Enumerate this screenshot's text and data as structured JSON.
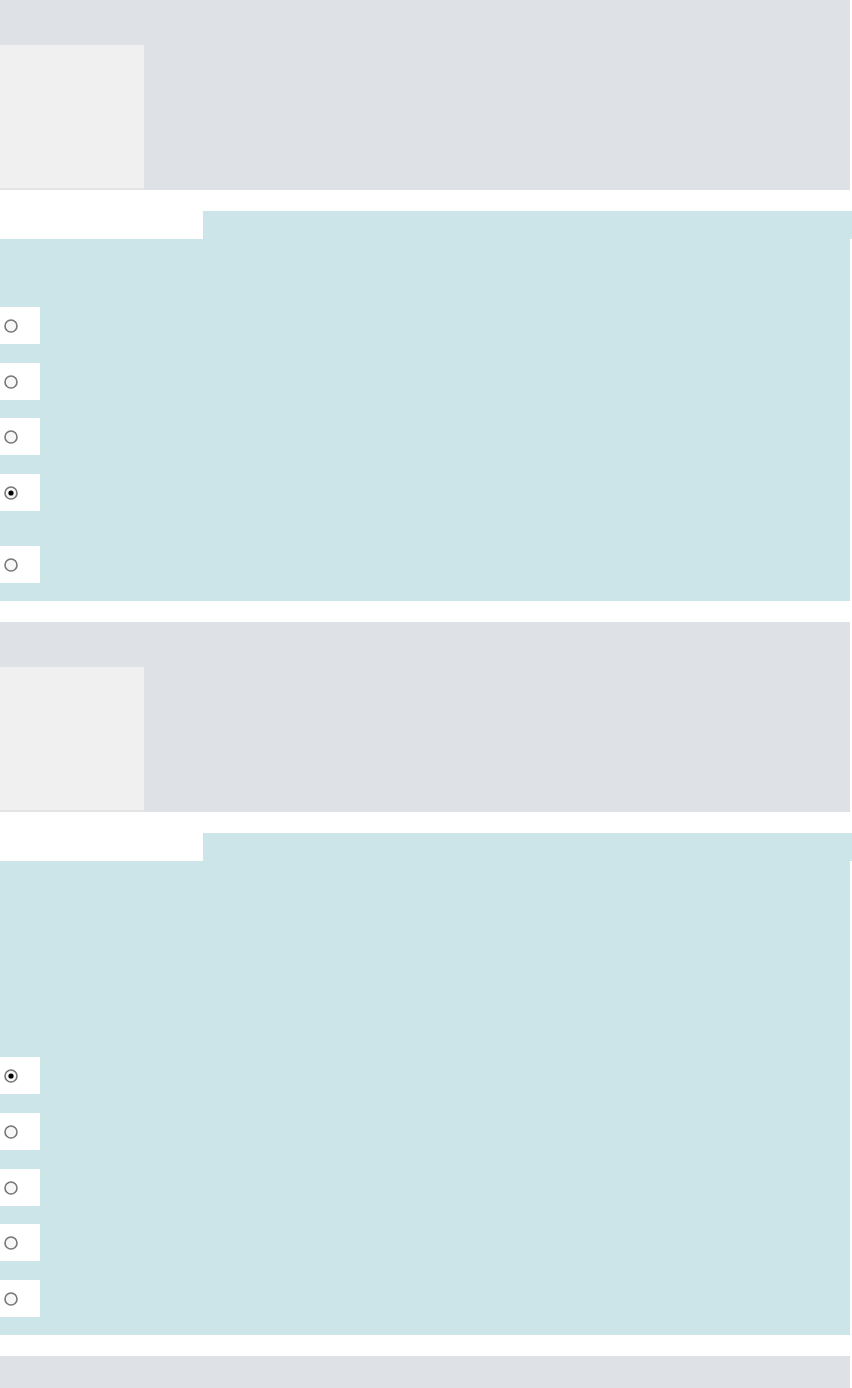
{
  "questions": [
    {
      "options": [
        {
          "selected": false
        },
        {
          "selected": false
        },
        {
          "selected": false
        },
        {
          "selected": true
        },
        {
          "selected": false
        }
      ]
    },
    {
      "options": [
        {
          "selected": true
        },
        {
          "selected": false
        },
        {
          "selected": false
        },
        {
          "selected": false
        },
        {
          "selected": false
        }
      ]
    }
  ]
}
